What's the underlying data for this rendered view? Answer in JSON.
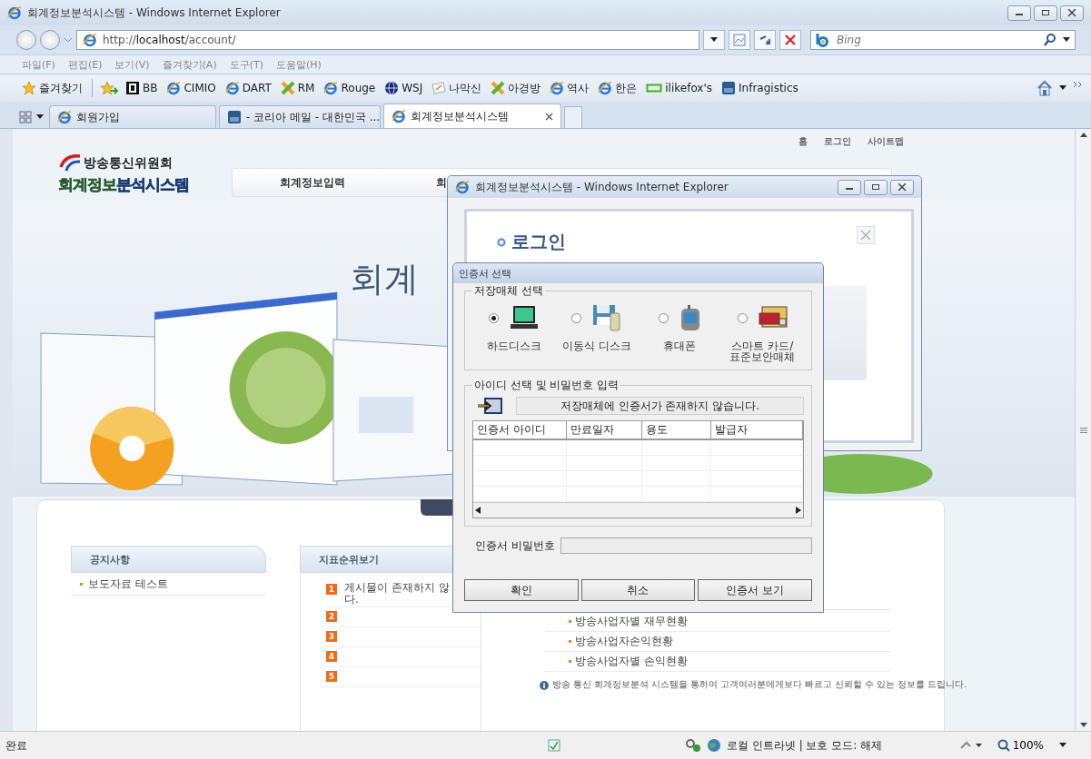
{
  "browser": {
    "title": "회계정보분석시스템 - Windows Internet Explorer",
    "address": "http://**localhost**/account/",
    "search_placeholder": "Bing",
    "menu": [
      "파일(F)",
      "편집(E)",
      "보기(V)",
      "즐겨찾기(A)",
      "도구(T)",
      "도움말(H)"
    ],
    "favorites_label": "즐겨찾기",
    "favorites": [
      {
        "label": "BB",
        "kind": "square"
      },
      {
        "label": "CIMIO",
        "kind": "ie"
      },
      {
        "label": "DART",
        "kind": "ie"
      },
      {
        "label": "RM",
        "kind": "cross"
      },
      {
        "label": "Rouge",
        "kind": "ie"
      },
      {
        "label": "WSJ",
        "kind": "globe"
      },
      {
        "label": "나막신",
        "kind": "note"
      },
      {
        "label": "아경방",
        "kind": "cross"
      },
      {
        "label": "역사",
        "kind": "ie"
      },
      {
        "label": "한은",
        "kind": "ie"
      },
      {
        "label": "ilikefox's",
        "kind": "frame"
      },
      {
        "label": "Infragistics",
        "kind": "tile"
      }
    ],
    "tabs": [
      {
        "label": "회원가입",
        "kind": "ie",
        "selected": false
      },
      {
        "label": "- 코리아 메일 - 대한민국 ...",
        "kind": "tile",
        "selected": false
      },
      {
        "label": "회계정보분석시스템",
        "kind": "ie",
        "selected": true
      }
    ]
  },
  "page": {
    "top_links": [
      "홈",
      "로그인",
      "사이트맵"
    ],
    "logo_org": "방송통신위원회",
    "logo_title_a": "회계정보",
    "logo_title_b": "분석시스템",
    "nav": [
      "회계정보입력",
      "회"
    ],
    "hero_title": "회계",
    "notice": {
      "title": "공지사항",
      "items": [
        "보도자료 테스트"
      ]
    },
    "ranking": {
      "title": "지표순위보기",
      "items": [
        {
          "rank": "1",
          "lines": [
            "게시물이 존재하지 않",
            "다."
          ]
        },
        {
          "rank": "2"
        },
        {
          "rank": "3"
        },
        {
          "rank": "4"
        },
        {
          "rank": "5"
        }
      ]
    },
    "reports": {
      "items": [
        "방송사업자별 재무현황",
        "방송사업자손익현황",
        "방송사업자별 손익현황"
      ]
    },
    "footnote": "방송 통신 회계정보분석 시스템을 통하여 고객여러분에게보다 빠르고 신뢰할 수 있는 정보를 드립니다."
  },
  "popup": {
    "title": "회계정보분석시스템 - Windows Internet Explorer",
    "heading": "로그인"
  },
  "dialog": {
    "title": "인증서 선택",
    "storage_group": "저장매체 선택",
    "storage": [
      {
        "label": "하드디스크",
        "kind": "laptop",
        "selected": true
      },
      {
        "label": "이동식 디스크",
        "kind": "floppy",
        "selected": false
      },
      {
        "label": "휴대폰",
        "kind": "phone",
        "selected": false
      },
      {
        "label": "스마트 카드/\n표준보안매체",
        "kind": "card",
        "selected": false
      }
    ],
    "id_group": "아이디 선택 및 비밀번호 입력",
    "message": "저장매체에 인증서가 존재하지 않습니다.",
    "columns": [
      "인증서 아이디",
      "만료일자",
      "용도",
      "발급자"
    ],
    "password_label": "인증서 비밀번호",
    "buttons": [
      "확인",
      "취소",
      "인증서 보기"
    ]
  },
  "status": {
    "text": "완료",
    "zone": "로컬 인트라넷 | 보호 모드: 해제",
    "zoom": "100%"
  }
}
